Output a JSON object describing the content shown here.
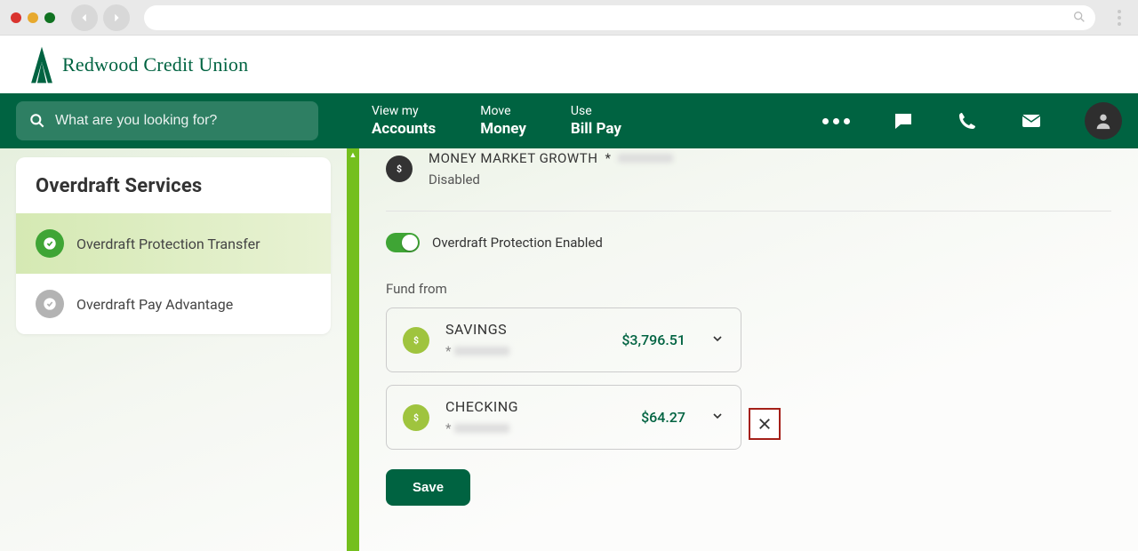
{
  "logo": {
    "text": "Redwood Credit Union"
  },
  "nav": {
    "search_placeholder": "What are you looking for?",
    "items": [
      {
        "line1": "View my",
        "line2": "Accounts"
      },
      {
        "line1": "Move",
        "line2": "Money"
      },
      {
        "line1": "Use",
        "line2": "Bill Pay"
      }
    ]
  },
  "sidebar": {
    "title": "Overdraft Services",
    "items": [
      {
        "label": "Overdraft Protection Transfer",
        "active": true
      },
      {
        "label": "Overdraft Pay Advantage",
        "active": false
      }
    ]
  },
  "main": {
    "account_row": {
      "name": "MONEY MARKET GROWTH",
      "mask_prefix": "*",
      "status": "Disabled"
    },
    "toggle": {
      "enabled": true,
      "label": "Overdraft Protection Enabled"
    },
    "fund_label": "Fund from",
    "fund_sources": [
      {
        "name": "SAVINGS",
        "mask_prefix": "*",
        "balance": "$3,796.51"
      },
      {
        "name": "CHECKING",
        "mask_prefix": "*",
        "balance": "$64.27"
      }
    ],
    "save_label": "Save"
  },
  "colors": {
    "brand_green": "#006341",
    "accent_green": "#3fa535",
    "lime": "#9fc43e"
  }
}
